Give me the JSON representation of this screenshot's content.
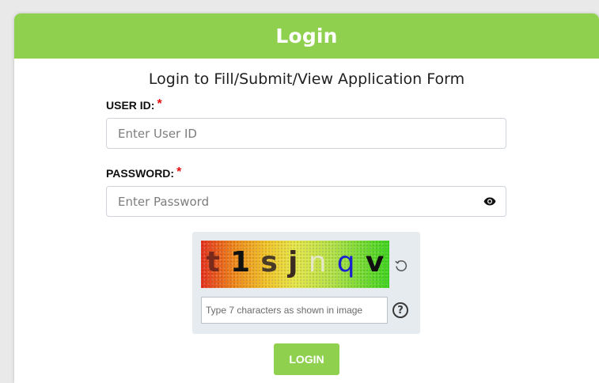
{
  "card": {
    "title": "Login",
    "subtitle": "Login to Fill/Submit/View Application Form",
    "header_color": "#8fd14f"
  },
  "user_id": {
    "label": "USER ID:",
    "required_mark": "*",
    "placeholder": "Enter User ID",
    "value": ""
  },
  "password": {
    "label": "PASSWORD:",
    "required_mark": "*",
    "placeholder": "Enter Password",
    "value": "",
    "toggle_icon": "eye-icon"
  },
  "captcha": {
    "characters": [
      "t",
      "1",
      "s",
      "j",
      "n",
      "q",
      "v"
    ],
    "input_placeholder": "Type 7 characters as shown in image",
    "input_value": "",
    "refresh_icon": "refresh-icon",
    "help_icon": "question-circle-icon",
    "help_glyph": "?"
  },
  "login_button": {
    "label": "LOGIN",
    "color": "#8fd14f"
  }
}
